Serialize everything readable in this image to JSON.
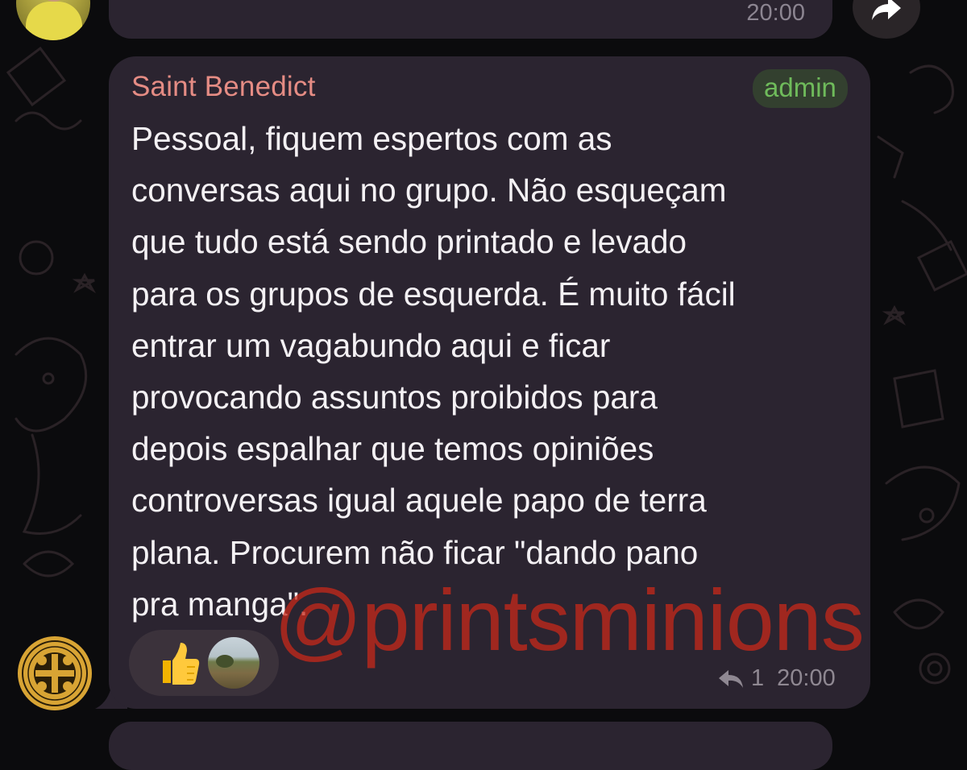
{
  "previous_message": {
    "time": "20:00"
  },
  "message": {
    "sender": "Saint Benedict",
    "badge": "admin",
    "lines": [
      "Pessoal, fiquem espertos com as",
      "conversas aqui no grupo. Não esqueçam",
      "que tudo está sendo printado e levado",
      "para os grupos de esquerda. É muito fácil",
      "entrar um vagabundo aqui e ficar",
      "provocando assuntos proibidos para",
      "depois espalhar que temos opiniões",
      "controversas igual aquele papo de terra",
      "plana. Procurem não ficar \"dando pano",
      "pra manga\"."
    ],
    "reaction_emoji": "thumbs-up-icon",
    "replies_count": "1",
    "time": "20:00"
  },
  "watermark": "@printsminions",
  "colors": {
    "background": "#0b0b0d",
    "bubble": "#2b2430",
    "sender": "#e58c84",
    "admin_badge_text": "#6fbb5b",
    "watermark": "#c82819"
  }
}
